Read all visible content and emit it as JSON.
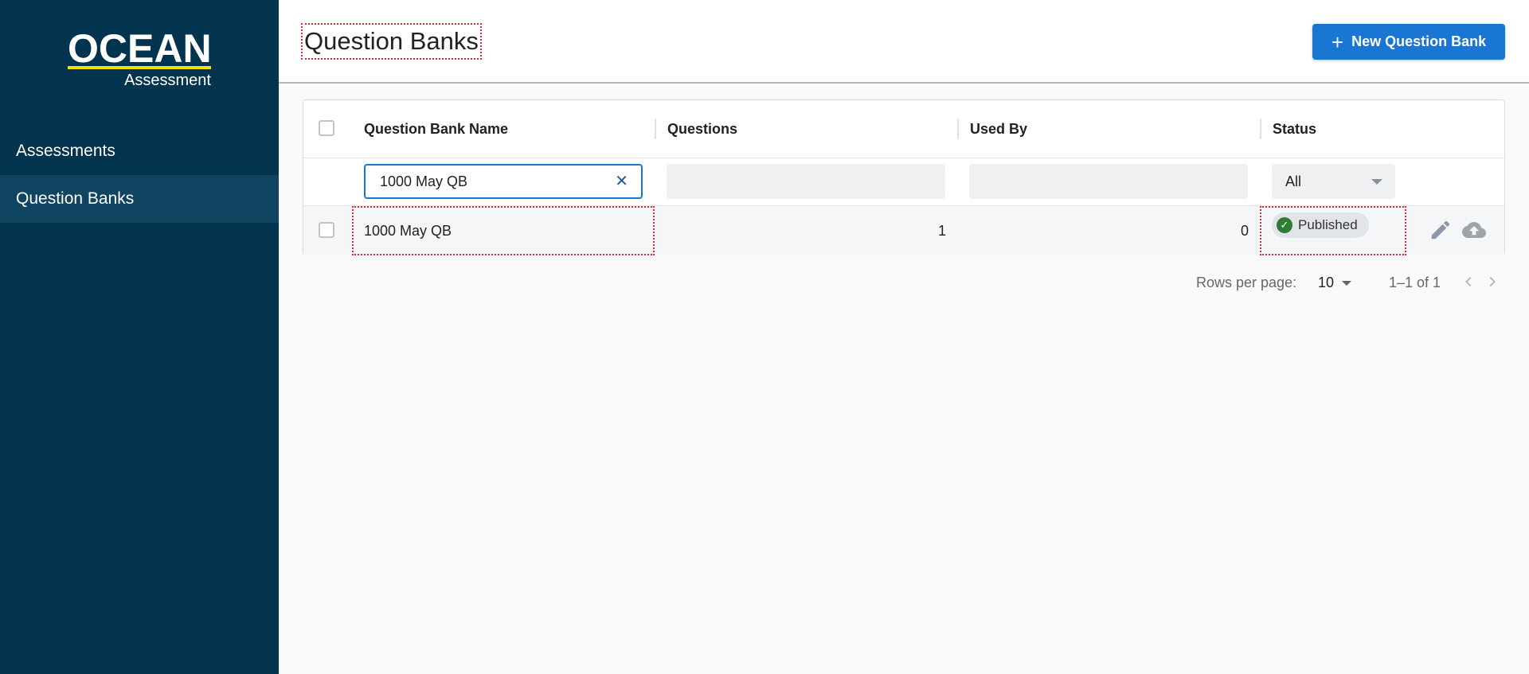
{
  "app": {
    "logo_word": "OCEAN",
    "logo_sub": "Assessment",
    "logo_line_color": "#f0e100",
    "sidebar_color": "#02344f"
  },
  "sidebar": {
    "items": [
      {
        "label": "Assessments",
        "active": false
      },
      {
        "label": "Question Banks",
        "active": true
      }
    ]
  },
  "header": {
    "title": "Question Banks",
    "new_button_label": "New Question Bank",
    "new_button_icon": "plus-icon",
    "accent_color": "#1976d2"
  },
  "table": {
    "columns": [
      "Question Bank Name",
      "Questions",
      "Used By",
      "Status"
    ],
    "filters": {
      "name_value": "1000 May QB",
      "questions_value": "",
      "used_by_value": "",
      "status_selected": "All"
    },
    "rows": [
      {
        "name": "1000 May QB",
        "questions": "1",
        "used_by": "0",
        "status": "Published",
        "status_icon": "check-circle-icon",
        "status_color": "#2e7d32",
        "actions": [
          "edit-icon",
          "cloud-upload-icon"
        ]
      }
    ]
  },
  "pagination": {
    "rows_per_page_label": "Rows per page:",
    "rows_per_page_value": "10",
    "range_label": "1–1 of 1"
  }
}
